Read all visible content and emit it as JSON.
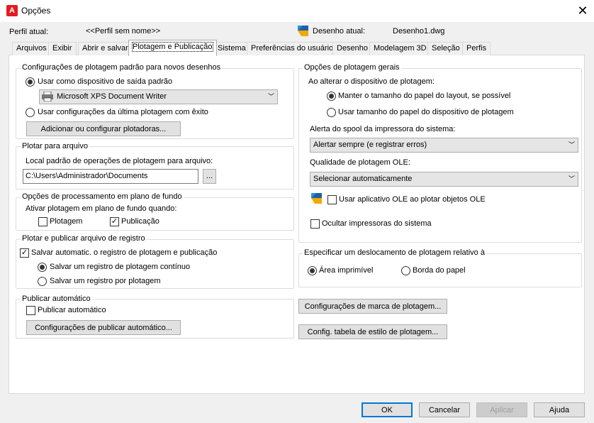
{
  "window": {
    "title": "Opções",
    "icon_letter": "A"
  },
  "profile": {
    "label": "Perfil atual:",
    "value": "<<Perfil sem nome>>",
    "drawing_label": "Desenho atual:",
    "drawing_value": "Desenho1.dwg"
  },
  "tabs": [
    "Arquivos",
    "Exibir",
    "Abrir e salvar",
    "Plotagem e Publicação",
    "Sistema",
    "Preferências do usuário",
    "Desenho",
    "Modelagem 3D",
    "Seleção",
    "Perfis"
  ],
  "default_plot": {
    "title": "Configurações de plotagem padrão para novos desenhos",
    "radio_default": "Usar como dispositivo de saída padrão",
    "device": "Microsoft XPS Document Writer",
    "radio_last": "Usar configurações da última plotagem com êxito",
    "add_button": "Adicionar ou configurar plotadoras..."
  },
  "plot_to_file": {
    "title": "Plotar para arquivo",
    "label": "Local padrão de operações de plotagem para arquivo:",
    "path": "C:\\Users\\Administrador\\Documents",
    "browse": "..."
  },
  "background": {
    "title": "Opções de processamento em plano de fundo",
    "label": "Ativar plotagem em plano de fundo quando:",
    "plot": "Plotagem",
    "publish": "Publicação"
  },
  "log": {
    "title": "Plotar e publicar arquivo de registro",
    "autosave": "Salvar automatic. o registro de plotagem e publicação",
    "continuous": "Salvar um registro de plotagem contínuo",
    "per_plot": "Salvar um registro por plotagem"
  },
  "autopublish": {
    "title": "Publicar automático",
    "check": "Publicar automático",
    "button": "Configurações de publicar automático..."
  },
  "general": {
    "title": "Opções de plotagem gerais",
    "when_changing": "Ao alterar o dispositivo de plotagem:",
    "keep_size": "Manter o tamanho do papel do layout, se possível",
    "use_device_size": "Usar tamanho do papel do dispositivo de plotagem",
    "spool_label": "Alerta do spool da impressora do sistema:",
    "spool_value": "Alertar sempre (e registrar erros)",
    "ole_label": "Qualidade de plotagem OLE:",
    "ole_value": "Selecionar automaticamente",
    "ole_app": "Usar aplicativo OLE ao plotar objetos OLE",
    "hide_printers": "Ocultar impressoras do sistema"
  },
  "offset": {
    "title": "Especificar um deslocamento de plotagem relativo à",
    "printable": "Área imprimível",
    "edge": "Borda do papel"
  },
  "stamp_button": "Configurações de marca de plotagem...",
  "style_button": "Config. tabela de estilo de plotagem...",
  "footer": {
    "ok": "OK",
    "cancel": "Cancelar",
    "apply": "Aplicar",
    "help": "Ajuda"
  }
}
